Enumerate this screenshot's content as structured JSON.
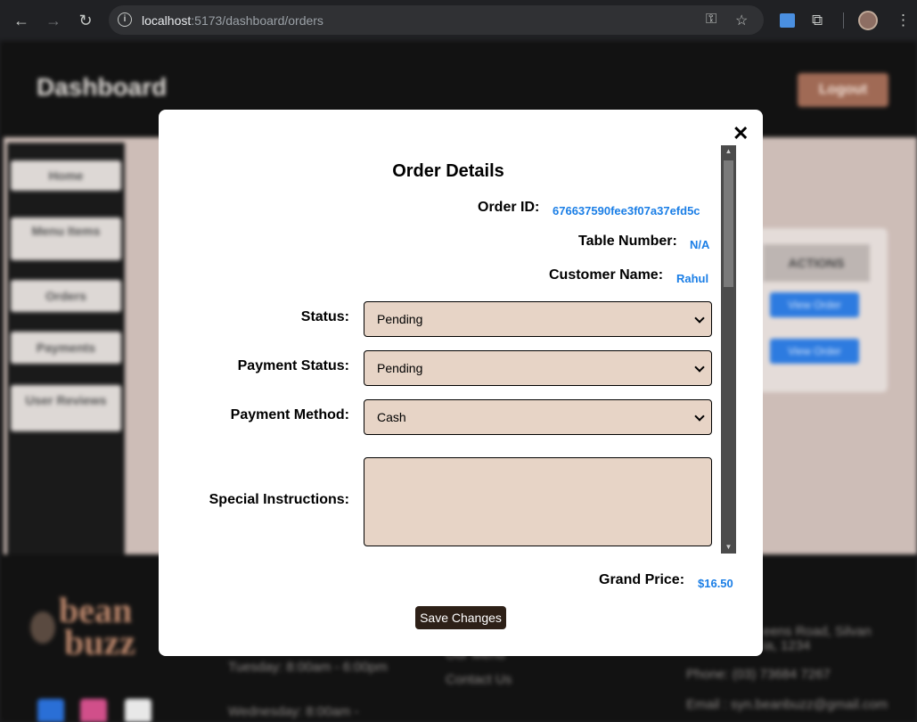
{
  "browser": {
    "url_host": "localhost",
    "url_rest": ":5173/dashboard/orders",
    "icons": [
      "back-icon",
      "forward-icon",
      "reload-icon",
      "site-info-icon",
      "key-icon",
      "star-icon",
      "extension-puzzle-icon",
      "profile-avatar",
      "menu-dots-icon"
    ]
  },
  "background": {
    "title": "Dashboard",
    "logout": "Logout",
    "sidebar": [
      {
        "label": "Home"
      },
      {
        "label": "Menu Items"
      },
      {
        "label": "Orders"
      },
      {
        "label": "Payments"
      },
      {
        "label": "User Reviews"
      }
    ],
    "actions_header": "ACTIONS",
    "view_order_label": "View Order",
    "footer": {
      "hours_1": "Tuesday: 8:00am - 6:00pm",
      "hours_2": "Wednesday: 8:00am -",
      "link_contact": "Contact Us",
      "link_menu": "Our Menu",
      "address_1": "eens Road, Silvan",
      "address_2": "ia, 1234",
      "phone": "Phone: (03) 73684 7267",
      "email": "Email : syn.beanbuzz@gmail.com",
      "logo_text": "bean buzz"
    }
  },
  "modal": {
    "title": "Order Details",
    "order_id_label": "Order ID:",
    "order_id_value": "676637590fee3f07a37efd5c",
    "table_number_label": "Table Number:",
    "table_number_value": "N/A",
    "customer_name_label": "Customer Name:",
    "customer_name_value": "Rahul",
    "status_label": "Status:",
    "status_value": "Pending",
    "payment_status_label": "Payment Status:",
    "payment_status_value": "Pending",
    "payment_method_label": "Payment Method:",
    "payment_method_value": "Cash",
    "special_instructions_label": "Special Instructions:",
    "special_instructions_value": "",
    "grand_price_label": "Grand Price:",
    "grand_price_value": "$16.50",
    "save_button": "Save Changes",
    "close_symbol": "✕"
  },
  "colors": {
    "select_bg": "#e7d4c6",
    "value_blue": "#1a7ee6",
    "save_btn_bg": "#2d2017"
  }
}
